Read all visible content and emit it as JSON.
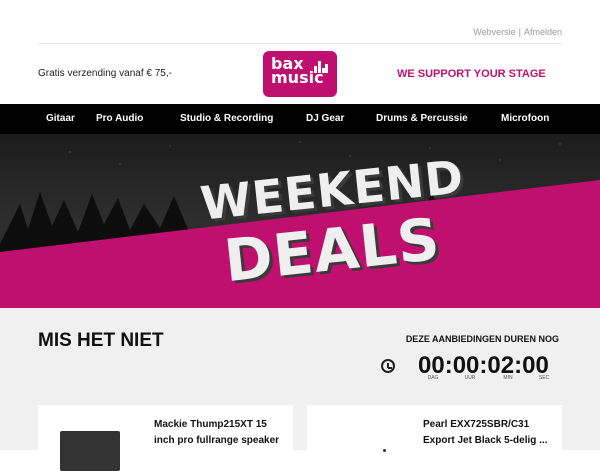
{
  "header": {
    "links": [
      "Webversie",
      "Afmelden"
    ],
    "shipping_text": "Gratis verzending vanaf € 75,-",
    "logo_text": [
      "bax",
      "music"
    ],
    "slogan": "WE SUPPORT YOUR STAGE"
  },
  "nav": {
    "items": [
      "Gitaar",
      "Pro Audio",
      "Studio & Recording",
      "DJ Gear",
      "Drums & Percussie",
      "Microfoon"
    ]
  },
  "hero": {
    "line1": "WEEKEND",
    "line2": "DEALS",
    "colors": {
      "accent": "#c0106f",
      "text": "#efefef"
    }
  },
  "section": {
    "title": "MIS HET NIET",
    "countdown_label": "DEZE AANBIEDINGEN DUREN NOG",
    "countdown": {
      "values": [
        "00",
        "00",
        "02",
        "00"
      ],
      "units": [
        "DAG",
        "UUR",
        "MIN",
        "SEC"
      ]
    }
  },
  "products": [
    {
      "name": "Mackie Thump215XT 15 inch pro fullrange speaker"
    },
    {
      "name": "Pearl EXX725SBR/C31 Export Jet Black 5-delig ..."
    }
  ],
  "colors": {
    "brand": "#c0106f",
    "nav_bg": "#000000",
    "section_bg": "#f0f0f0"
  }
}
